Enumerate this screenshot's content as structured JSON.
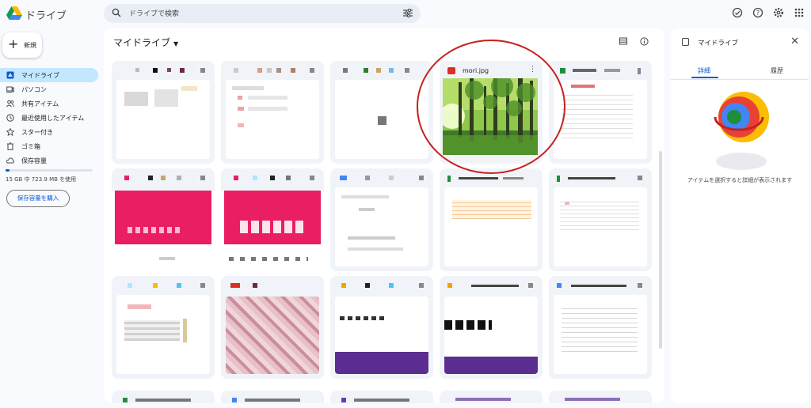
{
  "app": {
    "title": "ドライブ"
  },
  "search": {
    "placeholder": "ドライブで検索"
  },
  "top_icons": [
    "offline-status-icon",
    "help-icon",
    "settings-icon",
    "apps-grid-icon"
  ],
  "sidebar": {
    "new_label": "新規",
    "items": [
      {
        "label": "マイドライブ",
        "icon": "my-drive-icon",
        "active": true
      },
      {
        "label": "パソコン",
        "icon": "computer-icon"
      },
      {
        "label": "共有アイテム",
        "icon": "shared-icon"
      },
      {
        "label": "最近使用したアイテム",
        "icon": "recent-icon"
      },
      {
        "label": "スター付き",
        "icon": "star-icon"
      },
      {
        "label": "ゴミ箱",
        "icon": "trash-icon"
      },
      {
        "label": "保存容量",
        "icon": "cloud-icon"
      }
    ],
    "storage_text": "15 GB 中 723.9 MB を使用",
    "storage_fraction": 0.048,
    "buy_storage_label": "保存容量を購入"
  },
  "main": {
    "title": "マイドライブ",
    "files": [
      {
        "name": "mori.jpg",
        "type": "image"
      }
    ]
  },
  "details": {
    "title": "マイドライブ",
    "tabs": [
      "詳細",
      "履歴"
    ],
    "empty_message": "アイテムを選択すると詳細が表示されます"
  },
  "colors": {
    "accent": "#0b57d0",
    "active_nav": "#c2e7ff",
    "annotation_circle": "#c5221f",
    "background": "#f8fafd"
  }
}
